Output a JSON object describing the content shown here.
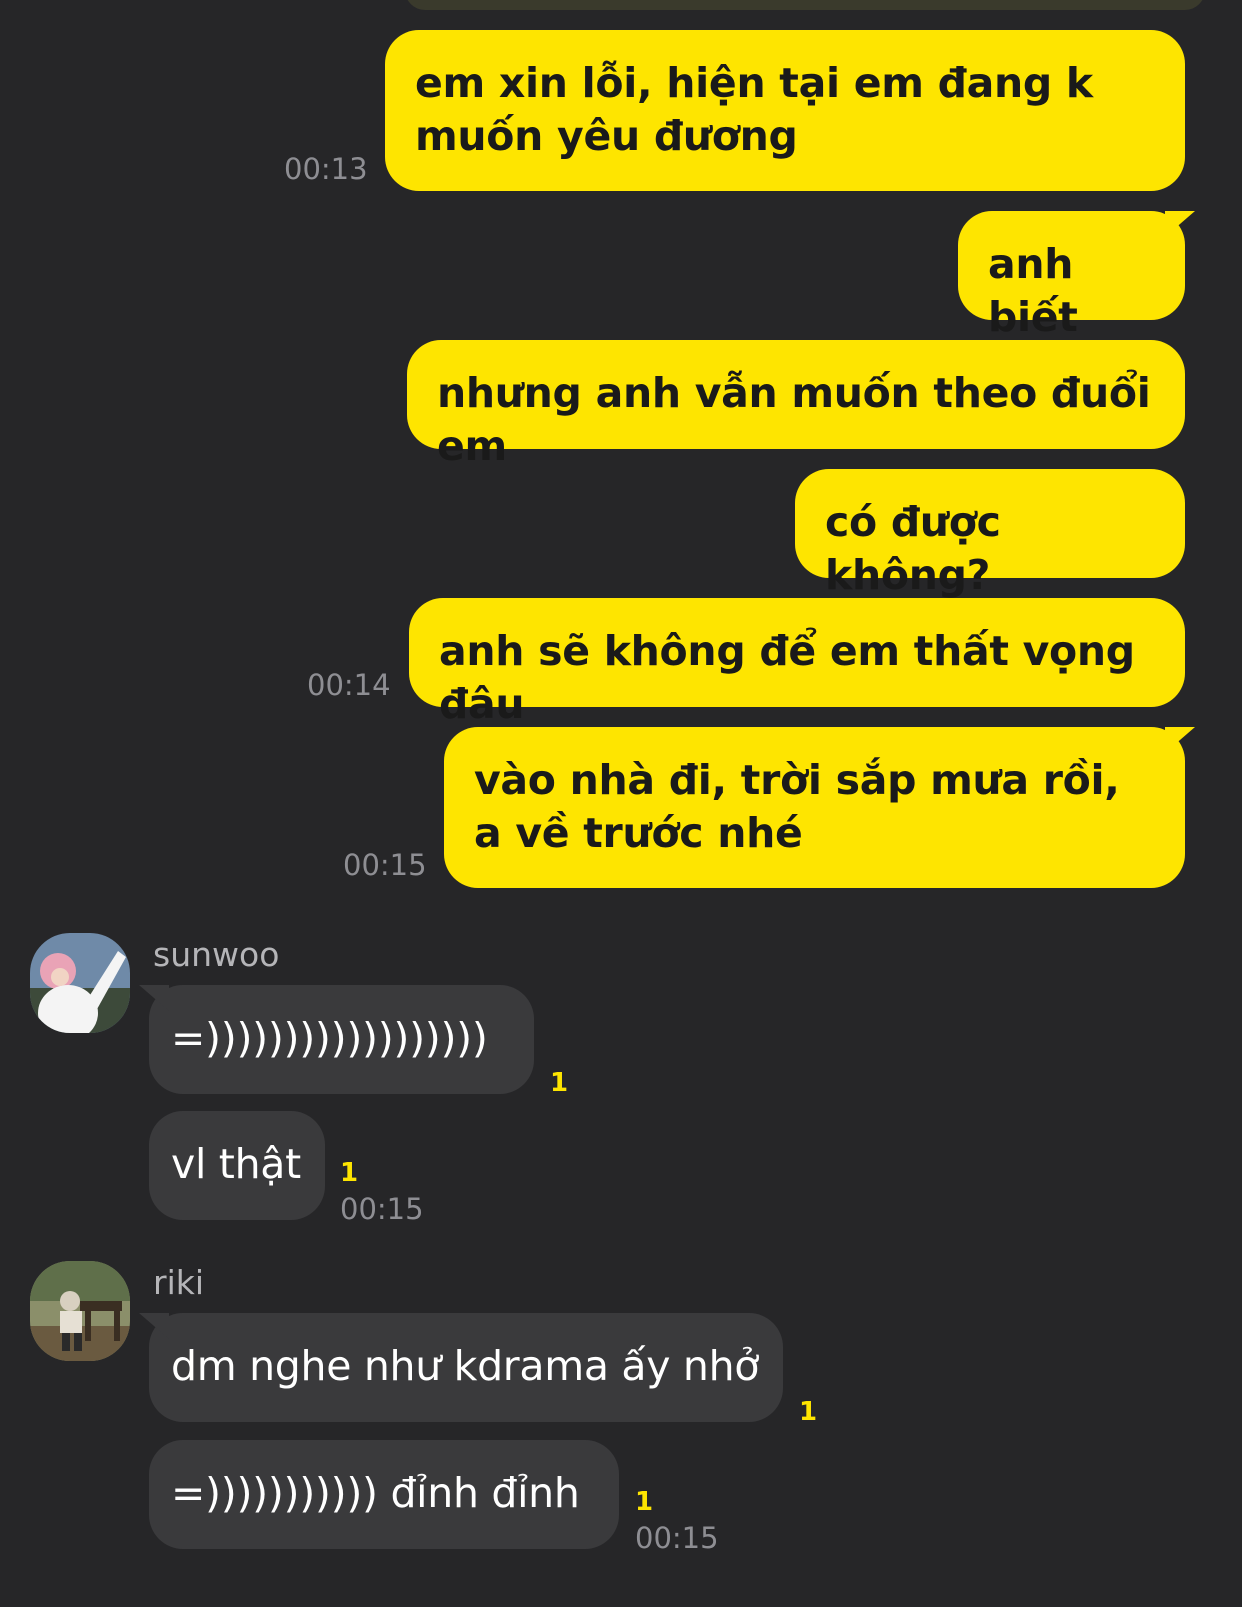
{
  "outgoing": [
    {
      "text": "em xin lỗi, hiện tại em đang k muốn yêu đương",
      "time": "00:13"
    },
    {
      "text": "anh biết"
    },
    {
      "text": "nhưng anh vẫn muốn theo đuổi em"
    },
    {
      "text": "có được không?"
    },
    {
      "text": "anh sẽ không để em thất vọng đâu",
      "time": "00:14"
    },
    {
      "text": "vào nhà đi, trời sắp mưa rồi, a về trước nhé",
      "time": "00:15"
    }
  ],
  "groups": [
    {
      "sender": "sunwoo",
      "avatar_icon": "profile-photo",
      "messages": [
        {
          "text": "=))))))))))))))))))",
          "unread": "1"
        },
        {
          "text": "vl thật",
          "unread": "1",
          "time": "00:15"
        }
      ]
    },
    {
      "sender": "riki",
      "avatar_icon": "profile-photo",
      "messages": [
        {
          "text": "dm nghe như kdrama ấy nhở",
          "unread": "1"
        },
        {
          "text": "=))))))))))) đỉnh đỉnh",
          "unread": "1",
          "time": "00:15"
        }
      ]
    }
  ],
  "colors": {
    "background": "#262628",
    "outgoing_bubble": "#fee500",
    "incoming_bubble": "#3a3a3c",
    "unread_count": "#fee500",
    "timestamp": "#8e8e93"
  }
}
